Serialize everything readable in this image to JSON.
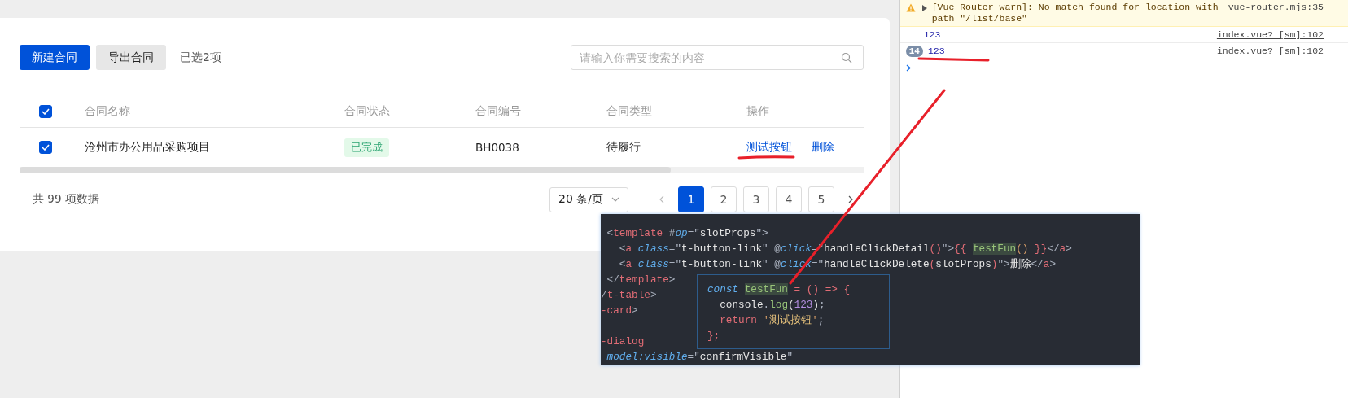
{
  "toolbar": {
    "buttons": [
      {
        "label": "新建合同",
        "kind": "primary"
      },
      {
        "label": "导出合同",
        "kind": "secondary"
      }
    ],
    "selection_info": "已选2项",
    "search": {
      "placeholder": "请输入你需要搜索的内容"
    }
  },
  "table": {
    "select_all": {
      "checked": true
    },
    "columns": [
      "合同名称",
      "合同状态",
      "合同编号",
      "合同类型",
      "操作"
    ],
    "rows": [
      {
        "checked": true,
        "name": "沧州市办公用品采购项目",
        "status": "已完成",
        "number": "BH0038",
        "type": "待履行",
        "actions": [
          "测试按钮",
          "删除"
        ]
      }
    ]
  },
  "pagination": {
    "total": "共 99 项数据",
    "page_size": "20 条/页",
    "pages": [
      {
        "label": "1",
        "selected": true
      },
      {
        "label": "2",
        "selected": false
      },
      {
        "label": "3",
        "selected": false
      },
      {
        "label": "4",
        "selected": false
      },
      {
        "label": "5",
        "selected": false
      }
    ]
  },
  "console": {
    "messages": [
      {
        "kind": "warning",
        "text": "[Vue Router warn]: No match found for location with path \"/list/base\"",
        "source": "vue-router.mjs:35"
      },
      {
        "kind": "log",
        "text": "123",
        "source": "index.vue? [sm]:102"
      },
      {
        "kind": "log",
        "count": "14",
        "text": "123",
        "source": "index.vue? [sm]:102"
      }
    ]
  },
  "code_preview": {
    "lines": [
      [
        {
          "kind": "punct",
          "text": " <"
        },
        {
          "kind": "tag",
          "text": "template"
        },
        {
          "kind": "punct",
          "text": " #"
        },
        {
          "kind": "attr",
          "text": "op"
        },
        {
          "kind": "punct",
          "text": "=\""
        },
        {
          "kind": "plain",
          "text": "slotProps"
        },
        {
          "kind": "punct",
          "text": "\">"
        }
      ],
      [
        {
          "kind": "punct",
          "text": "   <"
        },
        {
          "kind": "tag",
          "text": "a"
        },
        {
          "kind": "attr",
          "text": " class"
        },
        {
          "kind": "punct",
          "text": "=\""
        },
        {
          "kind": "plain",
          "text": "t-button-link"
        },
        {
          "kind": "punct",
          "text": "\" @"
        },
        {
          "kind": "attr",
          "text": "click"
        },
        {
          "kind": "punct",
          "text": "=\""
        },
        {
          "kind": "plain",
          "text": "handleClickDetail"
        },
        {
          "kind": "tag",
          "text": "()"
        },
        {
          "kind": "punct",
          "text": "\">"
        },
        {
          "kind": "tag",
          "text": "{{ "
        },
        {
          "kind": "hl",
          "text": "testFun"
        },
        {
          "kind": "num",
          "text": "()"
        },
        {
          "kind": "tag",
          "text": " }}"
        },
        {
          "kind": "punct",
          "text": "</"
        },
        {
          "kind": "tag",
          "text": "a"
        },
        {
          "kind": "punct",
          "text": ">"
        }
      ],
      [
        {
          "kind": "punct",
          "text": "   <"
        },
        {
          "kind": "tag",
          "text": "a"
        },
        {
          "kind": "attr",
          "text": " class"
        },
        {
          "kind": "punct",
          "text": "=\""
        },
        {
          "kind": "plain",
          "text": "t-button-link"
        },
        {
          "kind": "punct",
          "text": "\" @"
        },
        {
          "kind": "attr",
          "text": "click"
        },
        {
          "kind": "punct",
          "text": "=\""
        },
        {
          "kind": "plain",
          "text": "handleClickDelete"
        },
        {
          "kind": "tag",
          "text": "("
        },
        {
          "kind": "plain",
          "text": "slotProps"
        },
        {
          "kind": "tag",
          "text": ")"
        },
        {
          "kind": "punct",
          "text": "\">"
        },
        {
          "kind": "plain",
          "text": "删除"
        },
        {
          "kind": "punct",
          "text": "</"
        },
        {
          "kind": "tag",
          "text": "a"
        },
        {
          "kind": "punct",
          "text": ">"
        }
      ],
      [
        {
          "kind": "punct",
          "text": " </"
        },
        {
          "kind": "tag",
          "text": "template"
        },
        {
          "kind": "punct",
          "text": ">"
        }
      ],
      [
        {
          "kind": "punct",
          "text": "/"
        },
        {
          "kind": "tag",
          "text": "t-table"
        },
        {
          "kind": "punct",
          "text": ">"
        }
      ],
      [
        {
          "kind": "tag",
          "text": "-card"
        },
        {
          "kind": "punct",
          "text": ">"
        }
      ],
      [
        {
          "kind": "tag",
          "text": "-dialog"
        }
      ],
      [
        {
          "kind": "attr",
          "text": " model:visible"
        },
        {
          "kind": "punct",
          "text": "=\""
        },
        {
          "kind": "plain",
          "text": "confirmVisible"
        },
        {
          "kind": "punct",
          "text": "\""
        }
      ]
    ],
    "popup": {
      "lines": [
        [
          {
            "kind": "kw",
            "text": "const "
          },
          {
            "kind": "hl",
            "text": "testFun"
          },
          {
            "kind": "tag",
            "text": " = () => {"
          }
        ],
        [
          {
            "kind": "plain",
            "text": "  console"
          },
          {
            "kind": "punct",
            "text": "."
          },
          {
            "kind": "fn",
            "text": "log"
          },
          {
            "kind": "plain",
            "text": "("
          },
          {
            "kind": "num2",
            "text": "123"
          },
          {
            "kind": "plain",
            "text": ")"
          },
          {
            "kind": "punct",
            "text": ";"
          }
        ],
        [
          {
            "kind": "tag",
            "text": "  return "
          },
          {
            "kind": "num",
            "text": "'"
          },
          {
            "kind": "str",
            "text": "测试按钮"
          },
          {
            "kind": "num",
            "text": "'"
          },
          {
            "kind": "punct",
            "text": ";"
          }
        ],
        [
          {
            "kind": "tag",
            "text": "};"
          }
        ]
      ]
    }
  }
}
